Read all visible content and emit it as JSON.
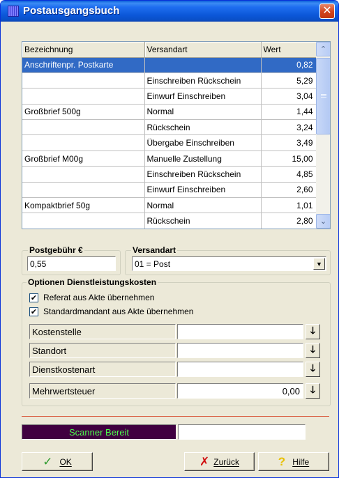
{
  "window": {
    "title": "Postausgangsbuch",
    "close_glyph": "✕"
  },
  "grid": {
    "columns": [
      "Bezeichnung",
      "Versandart",
      "Wert"
    ],
    "rows": [
      {
        "bezeichnung": "Anschriftenpr. Postkarte",
        "versandart": "",
        "wert": "0,82",
        "selected": true
      },
      {
        "bezeichnung": "",
        "versandart": "Einschreiben Rückschein",
        "wert": "5,29"
      },
      {
        "bezeichnung": "",
        "versandart": "Einwurf Einschreiben",
        "wert": "3,04"
      },
      {
        "bezeichnung": "Großbrief 500g",
        "versandart": "Normal",
        "wert": "1,44"
      },
      {
        "bezeichnung": "",
        "versandart": "Rückschein",
        "wert": "3,24"
      },
      {
        "bezeichnung": "",
        "versandart": "Übergabe Einschreiben",
        "wert": "3,49"
      },
      {
        "bezeichnung": "Großbrief M00g",
        "versandart": "Manuelle Zustellung",
        "wert": "15,00"
      },
      {
        "bezeichnung": "",
        "versandart": "Einschreiben Rückschein",
        "wert": "4,85"
      },
      {
        "bezeichnung": "",
        "versandart": "Einwurf Einschreiben",
        "wert": "2,60"
      },
      {
        "bezeichnung": "Kompaktbrief 50g",
        "versandart": "Normal",
        "wert": "1,01"
      },
      {
        "bezeichnung": "",
        "versandart": "Rückschein",
        "wert": "2,80"
      }
    ],
    "scroll_up_glyph": "⌃",
    "scroll_down_glyph": "⌄"
  },
  "postgebuehr": {
    "label": "Postgebühr €",
    "value": "0,55"
  },
  "versandart": {
    "label": "Versandart",
    "selected": "01 = Post",
    "dropdown_glyph": "▼"
  },
  "optionen": {
    "label": "Optionen Dienstleistungskosten",
    "checkboxes": [
      {
        "label": "Referat aus Akte übernehmen",
        "checked": true
      },
      {
        "label": "Standardmandant aus Akte übernehmen",
        "checked": true
      }
    ],
    "check_glyph": "✔",
    "fields": [
      {
        "label": "Kostenstelle",
        "value": ""
      },
      {
        "label": "Standort",
        "value": ""
      },
      {
        "label": "Dienstkostenart",
        "value": ""
      },
      {
        "label": "Mehrwertsteuer",
        "value": "0,00"
      }
    ],
    "arrow_glyph": "🡓"
  },
  "scanner": {
    "status": "Scanner Bereit"
  },
  "buttons": {
    "ok": {
      "label": "OK",
      "glyph": "✓"
    },
    "zurueck": {
      "label": "Zurück",
      "glyph": "✗"
    },
    "hilfe": {
      "label": "Hilfe",
      "glyph": "?"
    }
  },
  "colors": {
    "selection": "#316ac5",
    "scanner_bg": "#400040",
    "scanner_text": "#4cff4c",
    "ok_icon": "#2e9a2e",
    "cancel_icon": "#d01010",
    "help_icon": "#e8c000"
  }
}
